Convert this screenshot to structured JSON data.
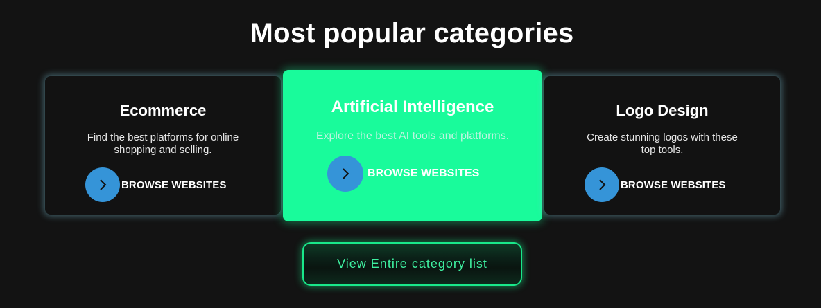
{
  "heading": "Most popular categories",
  "categories": [
    {
      "title": "Ecommerce",
      "description": "Find the best platforms for online shopping and selling.",
      "link_label": "BROWSE WEBSITES",
      "link_icon": "chevron-right-icon"
    },
    {
      "title": "Artificial Intelligence",
      "description": "Explore the best AI tools and platforms.",
      "link_label": "BROWSE WEBSITES",
      "link_icon": "chevron-right-icon"
    },
    {
      "title": "Logo Design",
      "description": "Create stunning logos with these top tools.",
      "link_label": "BROWSE WEBSITES",
      "link_icon": "chevron-right-icon"
    }
  ],
  "cta": {
    "label": "View Entire category list"
  },
  "colors": {
    "background": "#131313",
    "card_background": "#121212",
    "featured_background": "#19fb9b",
    "accent_blue": "#3594d8",
    "cta_border": "#19e88a",
    "cta_text": "#3ef0a0"
  }
}
